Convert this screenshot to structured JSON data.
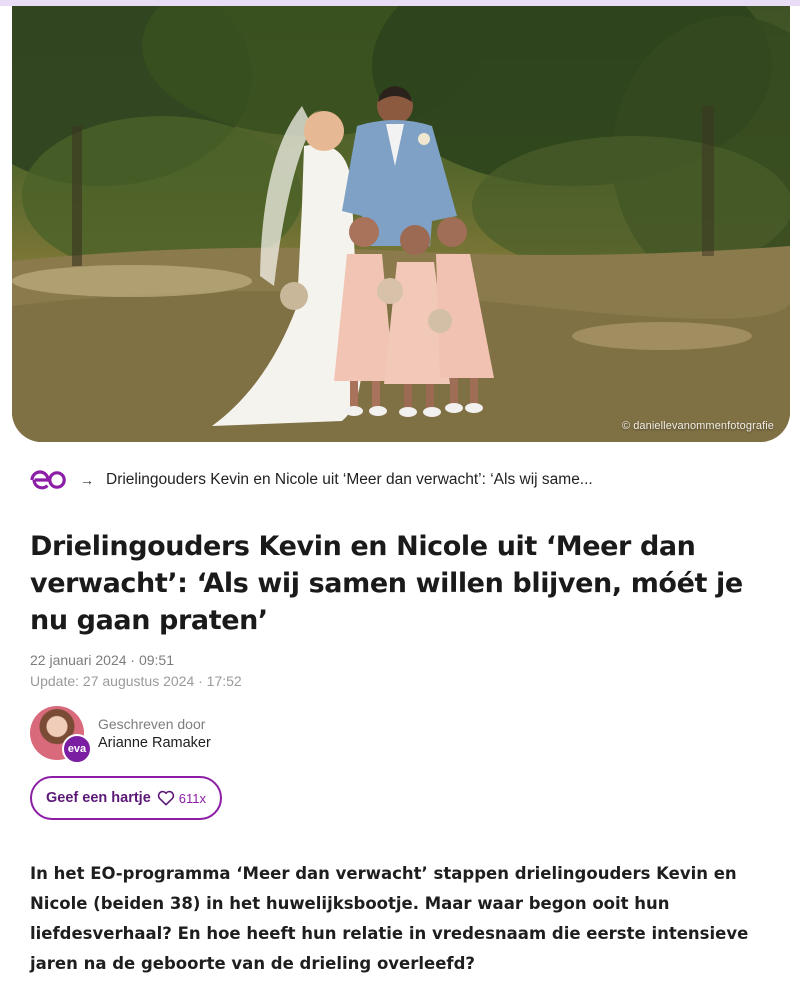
{
  "hero": {
    "photo_credit": "© daniellevanommenfotografie"
  },
  "breadcrumb": {
    "logo_text": "eo",
    "arrow": "→",
    "current": "Drielingouders Kevin en Nicole uit ‘Meer dan verwacht’: ‘Als wij same..."
  },
  "article": {
    "title": "Drielingouders Kevin en Nicole uit ‘Meer dan verwacht’: ‘Als wij samen willen blijven, móét je nu gaan praten’",
    "published": "22 januari 2024 · 09:51",
    "updated": "Update: 27 augustus 2024 · 17:52",
    "intro": "In het EO-programma ‘Meer dan verwacht’ stappen drielingouders Kevin en Nicole (beiden 38) in het huwelijksbootje. Maar waar begon ooit hun liefdesverhaal? En hoe heeft hun relatie in vredesnaam die eerste intensieve jaren na de geboorte van de drieling overleefd?"
  },
  "author": {
    "label": "Geschreven door",
    "name": "Arianne Ramaker",
    "badge": "eva"
  },
  "like": {
    "label": "Geef een hartje",
    "icon": "heart-outline-icon",
    "count": "611x"
  },
  "colors": {
    "brand_purple": "#8c1ea6",
    "accent_bar": "#e9dcf5"
  }
}
